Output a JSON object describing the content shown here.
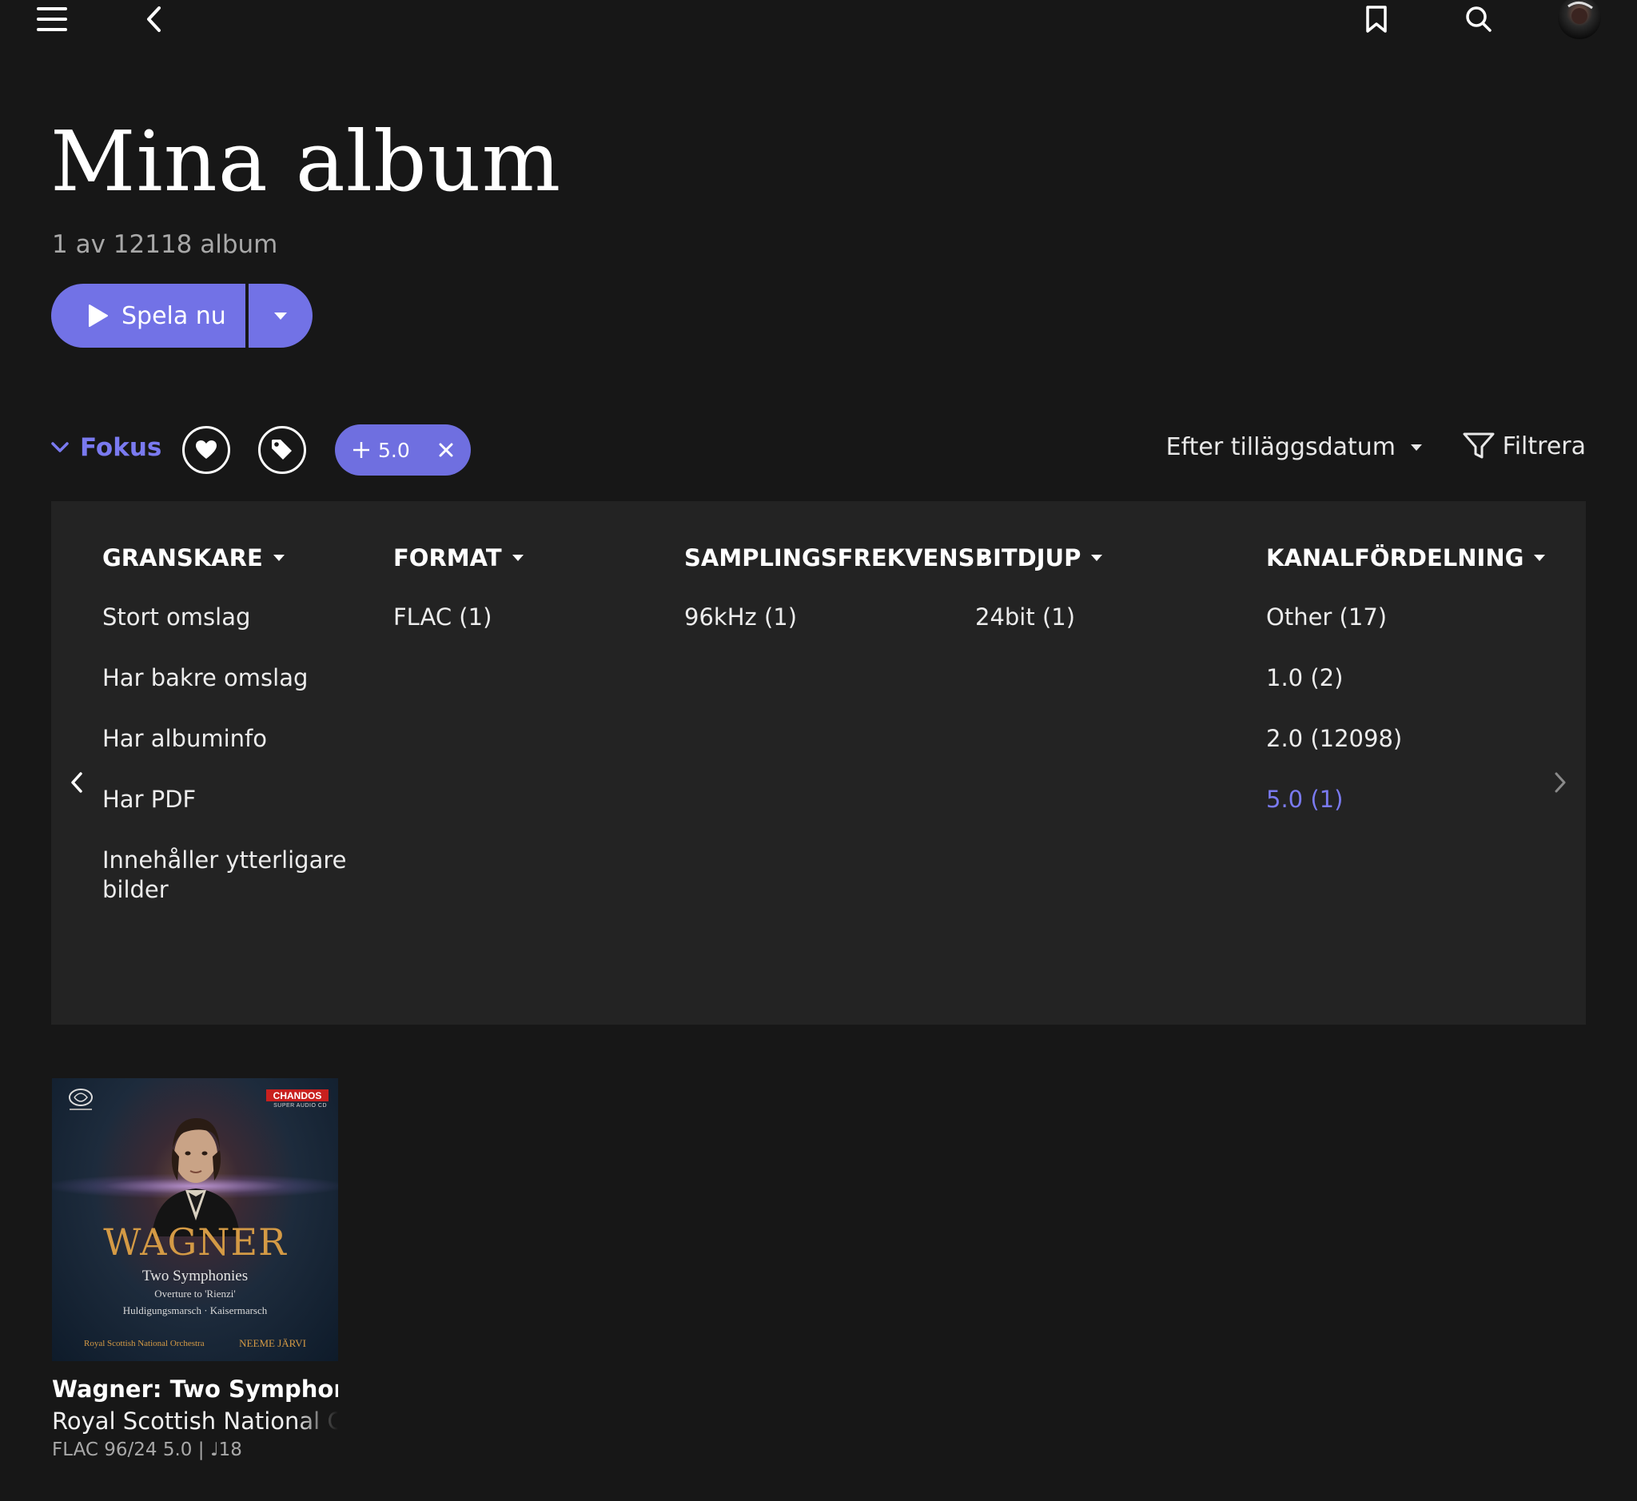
{
  "header": {
    "menu_icon": "hamburger-menu-icon",
    "back_icon": "chevron-left-icon",
    "bookmark_icon": "bookmark-icon",
    "search_icon": "search-icon",
    "avatar_icon": "user-avatar"
  },
  "page": {
    "title": "Mina album",
    "count": "1 av 12118 album"
  },
  "play": {
    "label": "Spela nu"
  },
  "toolbar": {
    "fokus_label": "Fokus",
    "chip_label": "5.0",
    "sort_label": "Efter tilläggsdatum",
    "filter_label": "Filtrera"
  },
  "filters": {
    "columns": [
      {
        "header": "GRANSKARE",
        "options": [
          "Stort omslag",
          "Har bakre omslag",
          "Har albuminfo",
          "Har PDF",
          "Innehåller ytterligare",
          "bilder"
        ]
      },
      {
        "header": "FORMAT",
        "options": [
          "FLAC (1)"
        ]
      },
      {
        "header": "SAMPLINGSFREKVENS",
        "options": [
          "96kHz (1)"
        ]
      },
      {
        "header": "BITDJUP",
        "options": [
          "24bit (1)"
        ]
      },
      {
        "header": "KANALFÖRDELNING",
        "options": [
          "Other (17)",
          "1.0 (2)",
          "2.0 (12098)",
          "5.0 (1)"
        ]
      }
    ]
  },
  "album": {
    "title": "Wagner: Two Symphonies",
    "artist": "Royal Scottish National Orchestra",
    "meta": "FLAC 96/24 5.0 | ♩18",
    "cover": {
      "label": "CHANDOS",
      "label_sub": "SUPER AUDIO CD",
      "composer": "WAGNER",
      "subtitle": "Two Symphonies",
      "line1": "Overture to 'Rienzi'",
      "line2": "Huldigungsmarsch · Kaisermarsch",
      "orchestra": "Royal Scottish National Orchestra",
      "conductor": "NEEME JÄRVI"
    }
  },
  "colors": {
    "accent": "#7272e6",
    "background": "#171717",
    "panel": "#232323"
  }
}
